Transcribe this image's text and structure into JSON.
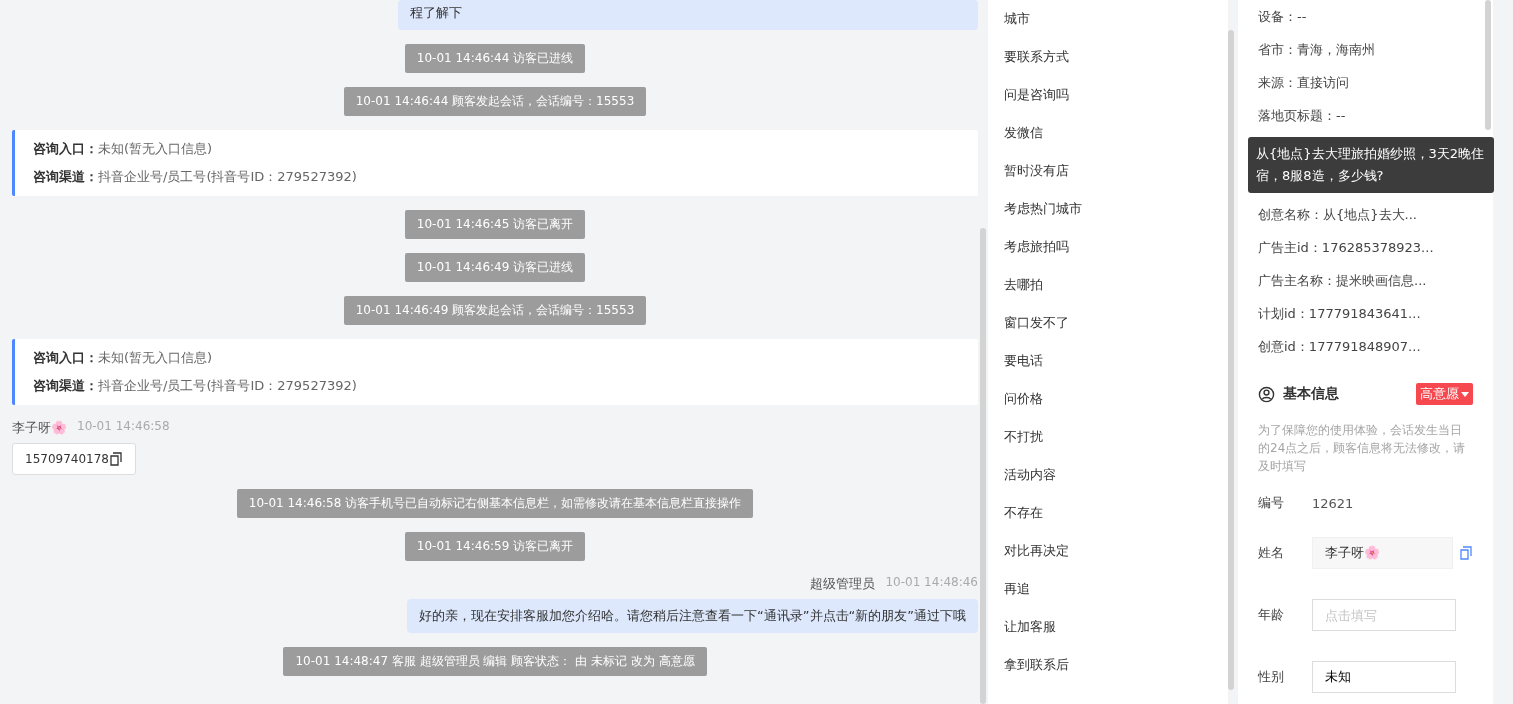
{
  "chat": {
    "messages": [
      {
        "kind": "agent",
        "text": "程了解下"
      },
      {
        "kind": "notice",
        "text": "10-01 14:46:44 访客已进线"
      },
      {
        "kind": "notice",
        "text": "10-01 14:46:44 顾客发起会话，会话编号：15553"
      },
      {
        "kind": "entry",
        "lines": [
          {
            "label": "咨询入口：",
            "value": "未知(暂无入口信息)"
          },
          {
            "label": "咨询渠道：",
            "value": "抖音企业号/员工号(抖音号ID：279527392)"
          }
        ]
      },
      {
        "kind": "notice",
        "text": "10-01 14:46:45 访客已离开"
      },
      {
        "kind": "notice",
        "text": "10-01 14:46:49 访客已进线"
      },
      {
        "kind": "notice",
        "text": "10-01 14:46:49 顾客发起会话，会话编号：15553"
      },
      {
        "kind": "entry",
        "lines": [
          {
            "label": "咨询入口：",
            "value": "未知(暂无入口信息)"
          },
          {
            "label": "咨询渠道：",
            "value": "抖音企业号/员工号(抖音号ID：279527392)"
          }
        ]
      },
      {
        "kind": "visitor",
        "sender": "李子呀🌸",
        "time": "10-01 14:46:58",
        "text": "15709740178"
      },
      {
        "kind": "notice",
        "text": "10-01 14:46:58 访客手机号已自动标记右侧基本信息栏，如需修改请在基本信息栏直接操作"
      },
      {
        "kind": "notice",
        "text": "10-01 14:46:59 访客已离开"
      },
      {
        "kind": "agent",
        "sender": "超级管理员",
        "time": "10-01 14:48:46",
        "text": "好的亲，现在安排客服加您介绍哈。请您稍后注意查看一下“通讯录”并点击“新的朋友”通过下哦"
      },
      {
        "kind": "notice",
        "text": "10-01 14:48:47 客服 超级管理员 编辑 顾客状态： 由 未标记 改为 高意愿"
      }
    ]
  },
  "quick_phrases": [
    "城市",
    "要联系方式",
    "问是咨询吗",
    "发微信",
    "暂时没有店",
    "考虑热门城市",
    "考虑旅拍吗",
    "去哪拍",
    "窗口发不了",
    "要电话",
    "问价格",
    "不打扰",
    "活动内容",
    "不存在",
    "对比再决定",
    "再追",
    "让加客服",
    "拿到联系后"
  ],
  "visit_info": {
    "rows_before": [
      "设备：--",
      "省市：青海，海南州",
      "来源：直接访问",
      "落地页标题：--"
    ],
    "tooltip": "从{地点}去大理旅拍婚纱照，3天2晚住宿，8服8造，多少钱?",
    "rows_after": [
      "创意名称：从{地点}去大...",
      "广告主id：176285378923...",
      "广告主名称：提米映画信息...",
      "计划id：177791843641...",
      "创意id：177791848907..."
    ]
  },
  "basic_info": {
    "title": "基本信息",
    "status": "高意愿",
    "notice": "为了保障您的使用体验，会话发生当日的24点之后，顾客信息将无法修改，请及时填写",
    "fields": [
      {
        "kind": "text",
        "label": "编号",
        "value": "12621"
      },
      {
        "kind": "locked",
        "label": "姓名",
        "value": "李子呀🌸"
      },
      {
        "kind": "input",
        "label": "年龄",
        "placeholder": "点击填写"
      },
      {
        "kind": "input",
        "label": "性别",
        "value": "未知"
      }
    ]
  }
}
